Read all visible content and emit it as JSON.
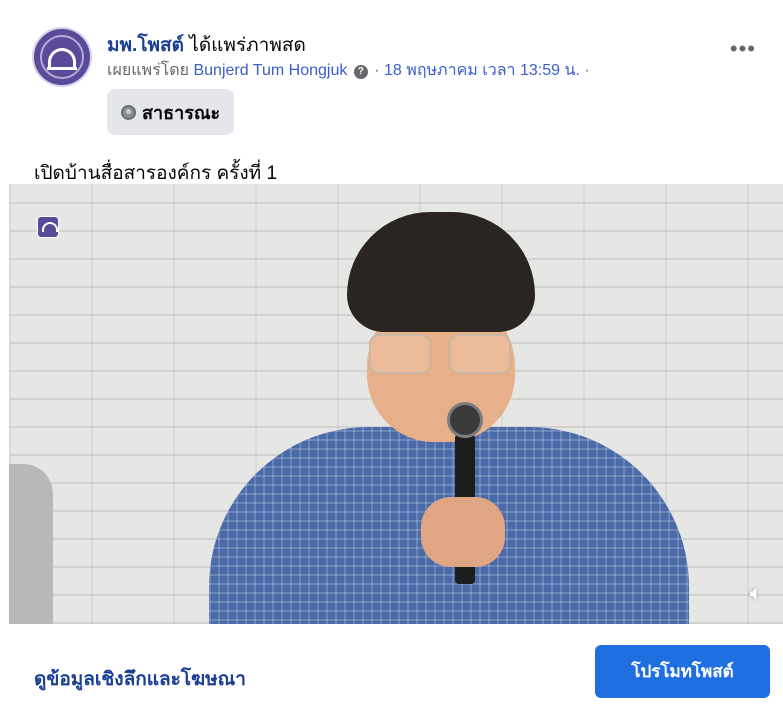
{
  "post": {
    "page_name": "มพ.โพสต์",
    "action_text": "ได้แพร่ภาพสด",
    "published_by_prefix": "เผยแพร่โดย",
    "author": "Bunjerd Tum Hongjuk",
    "info_icon": "question-circle-icon",
    "separator": "·",
    "date": "18 พฤษภาคม เวลา 13:59 น.",
    "trailing_separator": "·",
    "more_icon": "ellipsis-icon",
    "privacy": {
      "icon": "globe-icon",
      "label": "สาธารณะ"
    },
    "caption": "เปิดบ้านสื่อสารองค์กร ครั้งที่ 1"
  },
  "video": {
    "badge_icon": "page-logo-icon",
    "mute_icon": "speaker-muted-icon"
  },
  "footer": {
    "insights_link": "ดูข้อมูลเชิงลึกและโฆษณา",
    "promote_button": "โปรโมทโพสต์"
  },
  "colors": {
    "link": "#1c3f96",
    "primary_button": "#1f6fe0",
    "privacy_bg": "#e4e6eb",
    "meta_text": "#65676b"
  }
}
